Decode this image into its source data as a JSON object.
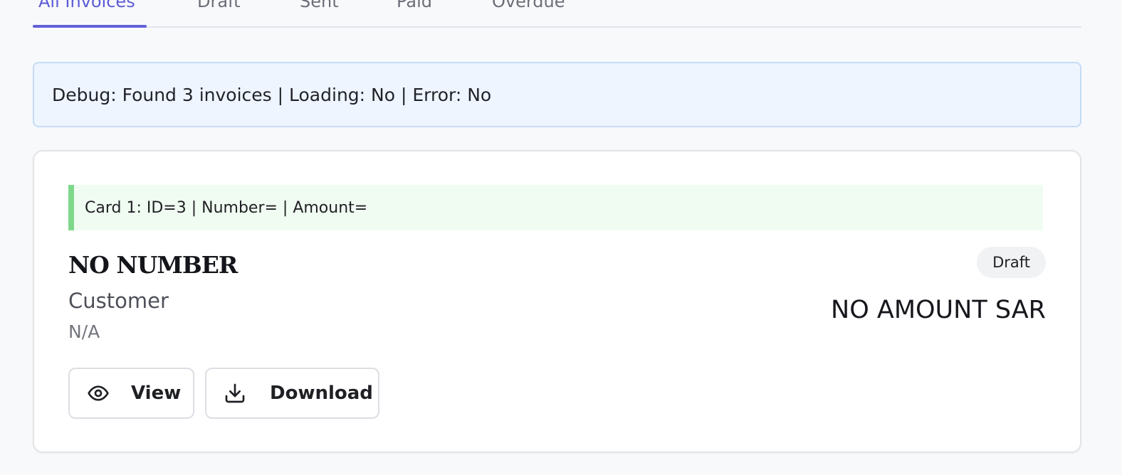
{
  "tabs": [
    {
      "label": "All Invoices",
      "active": true
    },
    {
      "label": "Draft",
      "active": false
    },
    {
      "label": "Sent",
      "active": false
    },
    {
      "label": "Paid",
      "active": false
    },
    {
      "label": "Overdue",
      "active": false
    }
  ],
  "debug": {
    "text": "Debug: Found 3 invoices | Loading: No | Error: No"
  },
  "card": {
    "debug_text": "Card 1: ID=3 | Number= | Amount=",
    "invoice_number": "NO NUMBER",
    "customer_label": "Customer",
    "customer_value": "N/A",
    "status": "Draft",
    "amount": "NO AMOUNT SAR",
    "view_label": "View",
    "download_label": "Download",
    "view_icon": "eye-icon",
    "download_icon": "download-icon"
  },
  "colors": {
    "accent": "#5b5bd6",
    "debug_bg": "#eef5fe",
    "card_debug_border": "#7ed88b"
  }
}
